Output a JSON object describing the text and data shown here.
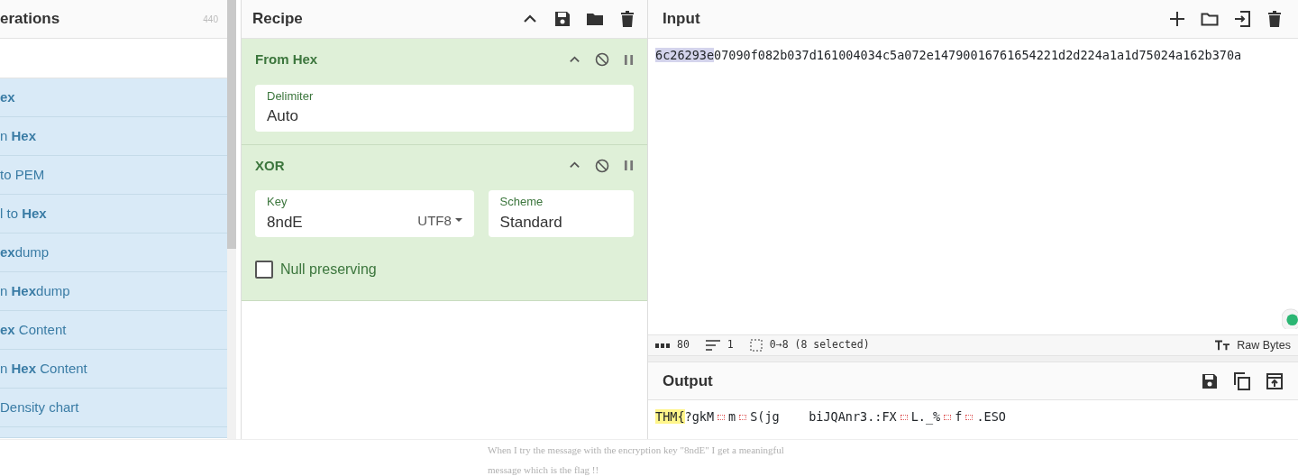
{
  "operations": {
    "title": "erations",
    "count": "440",
    "items": [
      {
        "label": "ex",
        "bold": true
      },
      {
        "label": "n **Hex**",
        "bold": false
      },
      {
        "label": "to PEM",
        "bold": false
      },
      {
        "label": "l to **Hex**",
        "bold": false
      },
      {
        "label": "**ex**dump",
        "bold": false
      },
      {
        "label": "n **Hex**dump",
        "bold": false
      },
      {
        "label": "**ex** Content",
        "bold": false
      },
      {
        "label": "n **Hex** Content",
        "bold": false
      },
      {
        "label": "Density chart",
        "bold": false
      }
    ]
  },
  "recipe": {
    "title": "Recipe",
    "steps": [
      {
        "name": "From Hex",
        "fields": [
          {
            "label": "Delimiter",
            "value": "Auto"
          }
        ]
      },
      {
        "name": "XOR",
        "fields": [
          {
            "label": "Key",
            "value": "8ndE",
            "option": "UTF8"
          },
          {
            "label": "Scheme",
            "value": "Standard"
          }
        ],
        "checkbox": {
          "label": "Null preserving",
          "checked": false
        }
      }
    ]
  },
  "input": {
    "title": "Input",
    "selected_text": "6c26293e",
    "text": "07090f082b037d161004034c5a072e14790016761654221d2d224a1a1d75024a162b370a",
    "status": {
      "length": "80",
      "lines": "1",
      "selection": "0→8 (8 selected)",
      "format": "Raw Bytes"
    }
  },
  "output": {
    "title": "Output",
    "segments": [
      {
        "kind": "match",
        "text": "THM{"
      },
      {
        "kind": "text",
        "text": "?gkM"
      },
      {
        "kind": "control"
      },
      {
        "kind": "text",
        "text": "m"
      },
      {
        "kind": "control"
      },
      {
        "kind": "text",
        "text": "S(jg    biJQAnr3.:FX"
      },
      {
        "kind": "control"
      },
      {
        "kind": "text",
        "text": "L._%"
      },
      {
        "kind": "control"
      },
      {
        "kind": "text",
        "text": "f"
      },
      {
        "kind": "control"
      },
      {
        "kind": "text",
        "text": ".ESO"
      }
    ]
  },
  "caption": [
    "When I try the message with the encryption key \"8ndE\" I get a meaningful",
    "message which is the flag !!"
  ]
}
